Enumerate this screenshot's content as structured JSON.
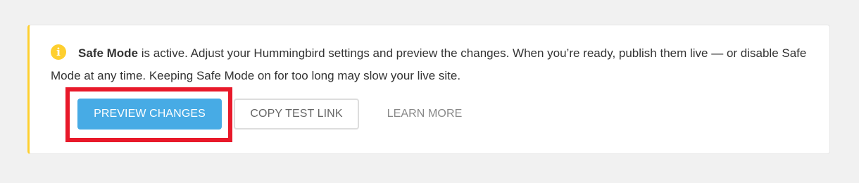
{
  "notice": {
    "icon": "info-icon",
    "icon_glyph": "i",
    "title": "Safe Mode",
    "message": " is active. Adjust your Hummingbird settings and preview the changes. When you’re ready, publish them live — or disable Safe Mode at any time. Keeping Safe Mode on for too long may slow your live site.",
    "accent_color": "#fecf2f"
  },
  "actions": {
    "preview_label": "PREVIEW CHANGES",
    "copy_label": "COPY TEST LINK",
    "learn_label": "LEARN MORE",
    "primary_color": "#47abe5"
  },
  "highlight": {
    "color": "#e8192a"
  }
}
